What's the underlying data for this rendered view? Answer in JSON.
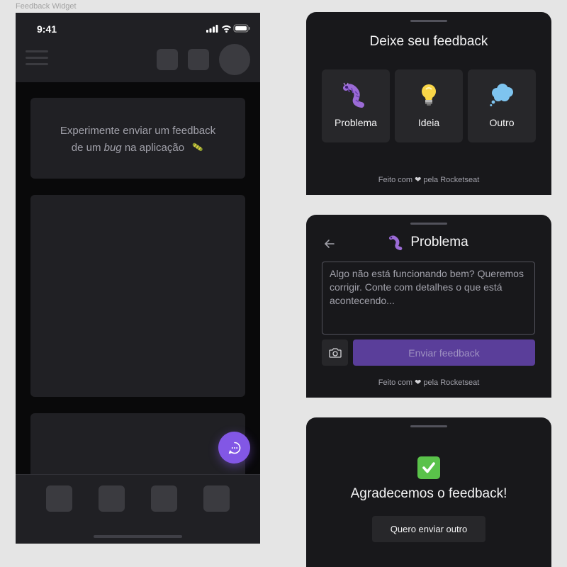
{
  "frame_label": "Feedback Widget",
  "phone": {
    "status_time": "9:41",
    "hint_line1": "Experimente enviar um feedback",
    "hint_line2_prefix": "de um ",
    "hint_line2_italic": "bug",
    "hint_line2_suffix": " na aplicação"
  },
  "widget_select": {
    "title": "Deixe seu feedback",
    "options": [
      {
        "label": "Problema",
        "icon": "bug-icon"
      },
      {
        "label": "Ideia",
        "icon": "lightbulb-icon"
      },
      {
        "label": "Outro",
        "icon": "thought-cloud-icon"
      }
    ],
    "footer_prefix": "Feito com",
    "footer_suffix": "pela Rocketseat"
  },
  "widget_form": {
    "title": "Problema",
    "placeholder": "Algo não está funcionando bem? Queremos corrigir. Conte com detalhes o que está acontecendo...",
    "submit_label": "Enviar feedback",
    "footer_prefix": "Feito com",
    "footer_suffix": "pela Rocketseat"
  },
  "widget_success": {
    "title": "Agradecemos o feedback!",
    "again_label": "Quero enviar outro"
  },
  "colors": {
    "brand": "#8257e5",
    "surface": "#18181b",
    "surface_secondary": "#27272a",
    "stroke": "#52525b",
    "success": "#5ac24a"
  }
}
